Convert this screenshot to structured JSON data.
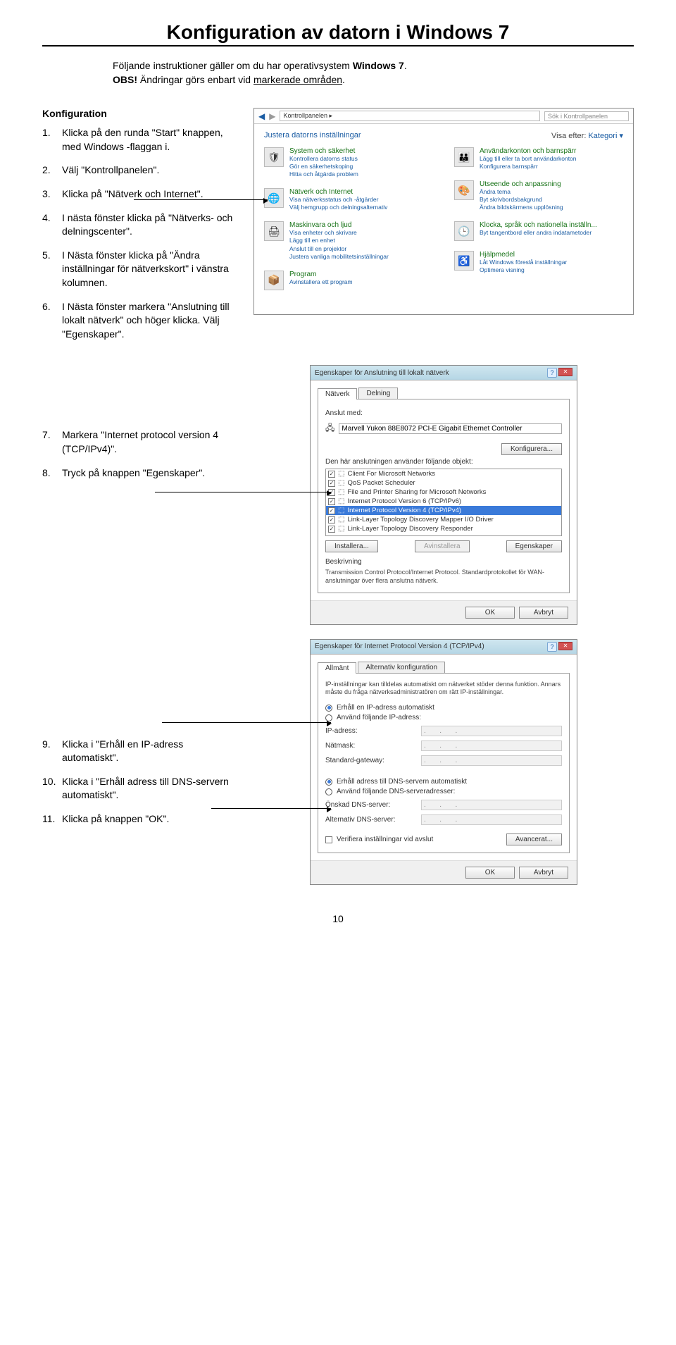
{
  "title": "Konfiguration av datorn i Windows 7",
  "intro_line1a": "Följande instruktioner gäller om du har operativsystem ",
  "intro_line1b_bold": "Windows 7",
  "intro_line2a_bold": "OBS!",
  "intro_line2b": " Ändringar görs enbart vid ",
  "intro_line2c_under": "markerade områden",
  "intro_line2d": ".",
  "konf_heading": "Konfiguration",
  "steps_a": [
    {
      "n": "1.",
      "t": "Klicka på den runda \"Start\" knappen, med Windows -flaggan i."
    },
    {
      "n": "2.",
      "t": "Välj \"Kontrollpanelen\"."
    },
    {
      "n": "3.",
      "t": "Klicka på \"Nätverk och Internet\"."
    },
    {
      "n": "4.",
      "t": "I nästa fönster klicka på \"Nätverks- och delningscenter\"."
    },
    {
      "n": "5.",
      "t": "I Nästa fönster klicka på \"Ändra inställningar för nätverkskort\" i vänstra kolumnen."
    },
    {
      "n": "6.",
      "t": "I Nästa fönster markera \"Anslutning till lokalt nätverk\" och höger klicka. Välj \"Egenskaper\"."
    }
  ],
  "steps_b": [
    {
      "n": "7.",
      "t": "Markera \"Internet protocol version 4 (TCP/IPv4)\"."
    },
    {
      "n": "8.",
      "t": "Tryck på knappen \"Egenskaper\"."
    }
  ],
  "steps_c": [
    {
      "n": "9.",
      "t": "Klicka i \"Erhåll en IP-adress automatiskt\"."
    },
    {
      "n": "10.",
      "t": "Klicka i \"Erhåll adress till DNS-servern automatiskt\"."
    },
    {
      "n": "11.",
      "t": "Klicka på knappen \"OK\"."
    }
  ],
  "cp": {
    "breadcrumb": "Kontrollpanelen ▸",
    "search_ph": "Sök i Kontrollpanelen",
    "heading": "Justera datorns inställningar",
    "view_label": "Visa efter:",
    "view_value": "Kategori ▾",
    "left_items": [
      {
        "icon": "🛡",
        "main": "System och säkerhet",
        "subs": "Kontrollera datorns status\nGör en säkerhetskoping\nHitta och åtgärda problem"
      },
      {
        "icon": "🌐",
        "main": "Nätverk och Internet",
        "subs": "Visa nätverksstatus och -åtgärder\nVälj hemgrupp och delningsalternativ"
      },
      {
        "icon": "🖨",
        "main": "Maskinvara och ljud",
        "subs": "Visa enheter och skrivare\nLägg till en enhet\nAnslut till en projektor\nJustera vanliga mobilitetsinställningar"
      },
      {
        "icon": "📦",
        "main": "Program",
        "subs": "Avinstallera ett program"
      }
    ],
    "right_items": [
      {
        "icon": "👪",
        "main": "Användarkonton och barnspärr",
        "subs": "Lägg till eller ta bort användarkonton\nKonfigurera barnspärr"
      },
      {
        "icon": "🎨",
        "main": "Utseende och anpassning",
        "subs": "Ändra tema\nByt skrivbordsbakgrund\nÄndra bildskärmens upplösning"
      },
      {
        "icon": "🕒",
        "main": "Klocka, språk och nationella inställn...",
        "subs": "Byt tangentbord eller andra indatametoder"
      },
      {
        "icon": "♿",
        "main": "Hjälpmedel",
        "subs": "Låt Windows föreslå inställningar\nOptimera visning"
      }
    ]
  },
  "props": {
    "title": "Egenskaper för Anslutning till lokalt nätverk",
    "tab1": "Nätverk",
    "tab2": "Delning",
    "connect_label": "Anslut med:",
    "adapter": "Marvell Yukon 88E8072 PCI-E Gigabit Ethernet Controller",
    "configure": "Konfigurera...",
    "uses_label": "Den här anslutningen använder följande objekt:",
    "items": [
      "Client For Microsoft Networks",
      "QoS Packet Scheduler",
      "File and Printer Sharing for Microsoft Networks",
      "Internet Protocol Version 6 (TCP/IPv6)",
      "Internet Protocol Version 4 (TCP/IPv4)",
      "Link-Layer Topology Discovery Mapper I/O Driver",
      "Link-Layer Topology Discovery Responder"
    ],
    "selected_index": 4,
    "install": "Installera...",
    "uninstall": "Avinstallera",
    "properties": "Egenskaper",
    "desc_label": "Beskrivning",
    "desc_text": "Transmission Control Protocol/Internet Protocol. Standardprotokollet för WAN-anslutningar över flera anslutna nätverk.",
    "ok": "OK",
    "cancel": "Avbryt"
  },
  "ipv4": {
    "title": "Egenskaper för Internet Protocol Version 4 (TCP/IPv4)",
    "tab1": "Allmänt",
    "tab2": "Alternativ konfiguration",
    "blurb": "IP-inställningar kan tilldelas automatiskt om nätverket stöder denna funktion. Annars måste du fråga nätverksadministratören om rätt IP-inställningar.",
    "r1": "Erhåll en IP-adress automatiskt",
    "r2": "Använd följande IP-adress:",
    "ip_label": "IP-adress:",
    "mask_label": "Nätmask:",
    "gw_label": "Standard-gateway:",
    "r3": "Erhåll adress till DNS-servern automatiskt",
    "r4": "Använd följande DNS-serveradresser:",
    "dns1_label": "Önskad DNS-server:",
    "dns2_label": "Alternativ DNS-server:",
    "verify": "Verifiera inställningar vid avslut",
    "advanced": "Avancerat...",
    "ok": "OK",
    "cancel": "Avbryt",
    "dots": ".       .       ."
  },
  "page_number": "10"
}
